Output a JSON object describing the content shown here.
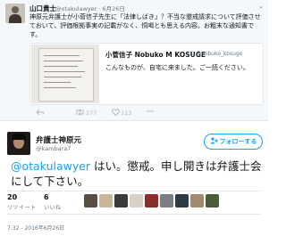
{
  "top_tweet": {
    "name": "山口貴士",
    "handle_date": "@otakulawyer · 6月26日",
    "caret": "⌄",
    "text": "神原元弁護士が小菅信子先生に「法律しばき」？不当な懲戒請求について評価させておいて、評価根拠事実の記載がなく、恫喝とも思える内容。お粗末な通知書です。",
    "quote": {
      "name": "小菅信子 Nobuko M KOSUGE",
      "handle": "@nobuko_kosuge",
      "text": "こんなものが、自宅に来ました。ご一読ください。"
    },
    "retweet_count": "277",
    "like_count": "113"
  },
  "main_tweet": {
    "name": "弁護士神原元",
    "handle": "@kambara7",
    "follow_label": "フォローする",
    "mention": "@otakulawyer",
    "body": " はい。懲戒。申し開きは弁護士会にして下さい。",
    "retweets": "20",
    "retweets_label": "リツイート",
    "likes": "6",
    "likes_label": "いいね",
    "timestamp": "7:32 - 2016年6月26日"
  },
  "colors": {
    "accent": "#1da1f2",
    "muted": "#657786",
    "icon_muted": "#aab8c2",
    "border": "#e1e8ed"
  },
  "icons": [
    "reply-icon",
    "retweet-icon",
    "heart-icon",
    "more-icon",
    "person-plus-icon"
  ]
}
